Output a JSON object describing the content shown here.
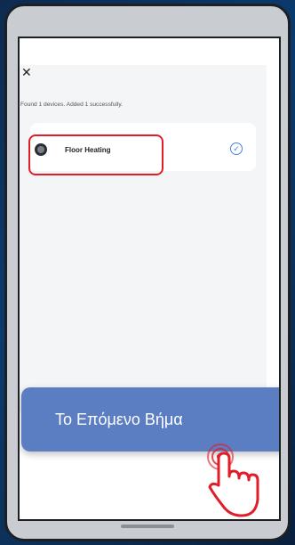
{
  "dialog": {
    "close_icon": "close-icon",
    "found_text": "Found 1 devices. Added 1 successfully."
  },
  "device": {
    "name": "Floor Heating",
    "icon": "device-icon",
    "status_icon": "check-icon"
  },
  "next_button": {
    "label": "Το Επόμενο Βήμα"
  },
  "colors": {
    "accent": "#5b7ec2",
    "highlight": "#e21d2a",
    "check": "#4a82d8"
  }
}
